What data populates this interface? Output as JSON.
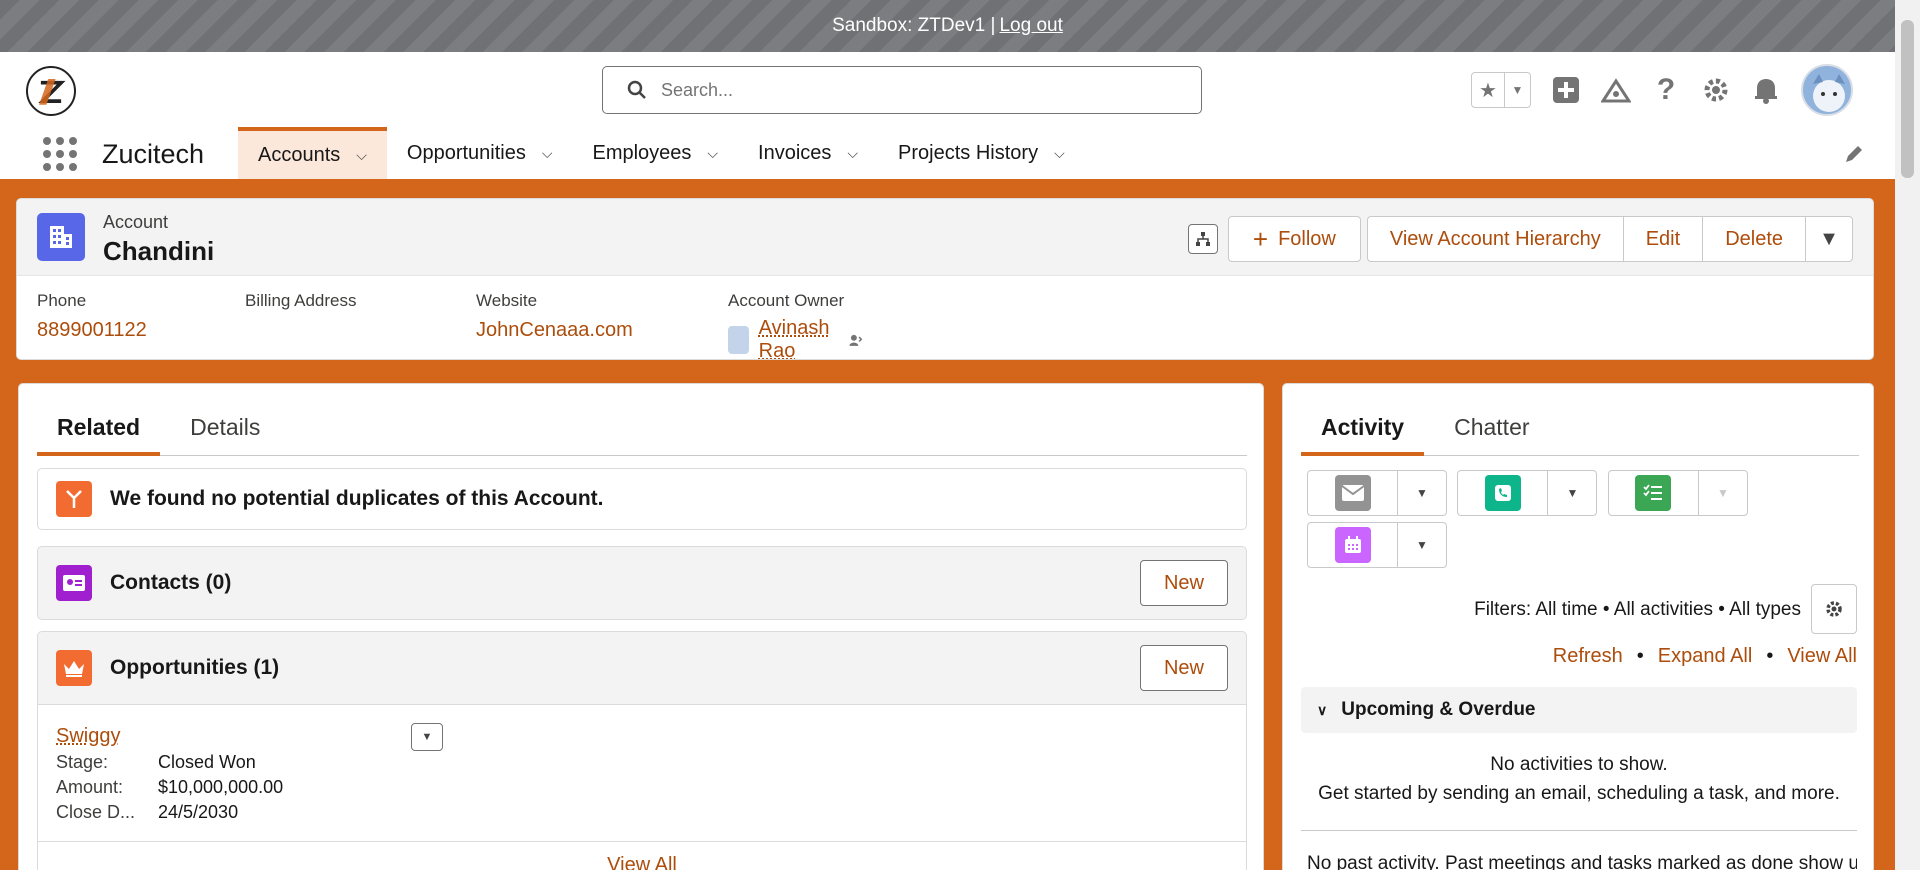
{
  "sandbox": {
    "text": "Sandbox: ZTDev1 |",
    "logout": "Log out"
  },
  "header": {
    "search_placeholder": "Search...",
    "icons": [
      "favorites-star-icon",
      "add-icon",
      "trailhead-icon",
      "help-icon",
      "setup-gear-icon",
      "notifications-bell-icon",
      "user-avatar"
    ]
  },
  "nav": {
    "app_name": "Zucitech",
    "items": [
      {
        "label": "Accounts",
        "active": true
      },
      {
        "label": "Opportunities"
      },
      {
        "label": "Employees"
      },
      {
        "label": "Invoices"
      },
      {
        "label": "Projects History"
      }
    ]
  },
  "record": {
    "type": "Account",
    "name": "Chandini",
    "actions": {
      "follow": "Follow",
      "hierarchy": "View Account Hierarchy",
      "edit": "Edit",
      "delete": "Delete"
    },
    "fields": {
      "phone_label": "Phone",
      "phone": "8899001122",
      "billing_label": "Billing Address",
      "website_label": "Website",
      "website": "JohnCenaaa.com",
      "owner_label": "Account Owner",
      "owner": "Avinash Rao"
    }
  },
  "left": {
    "tabs": [
      "Related",
      "Details"
    ],
    "duplicates": "We found no potential duplicates of this Account.",
    "contacts": {
      "title": "Contacts (0)",
      "new": "New"
    },
    "opportunities": {
      "title": "Opportunities (1)",
      "new": "New",
      "record": {
        "name": "Swiggy",
        "stage_label": "Stage:",
        "stage": "Closed Won",
        "amount_label": "Amount:",
        "amount": "$10,000,000.00",
        "close_label": "Close D...",
        "close": "24/5/2030"
      },
      "view_all": "View All"
    }
  },
  "right": {
    "tabs": [
      "Activity",
      "Chatter"
    ],
    "filters": "Filters: All time • All activities • All types",
    "links": {
      "refresh": "Refresh",
      "expand": "Expand All",
      "view_all": "View All"
    },
    "upcoming": "Upcoming & Overdue",
    "no_activities": "No activities to show.",
    "get_started": "Get started by sending an email, scheduling a task, and more.",
    "past": "No past activity. Past meetings and tasks marked as done show up here."
  },
  "colors": {
    "brand": "#d4661c",
    "link": "#ad4d0c",
    "account_icon": "#5867e8"
  }
}
